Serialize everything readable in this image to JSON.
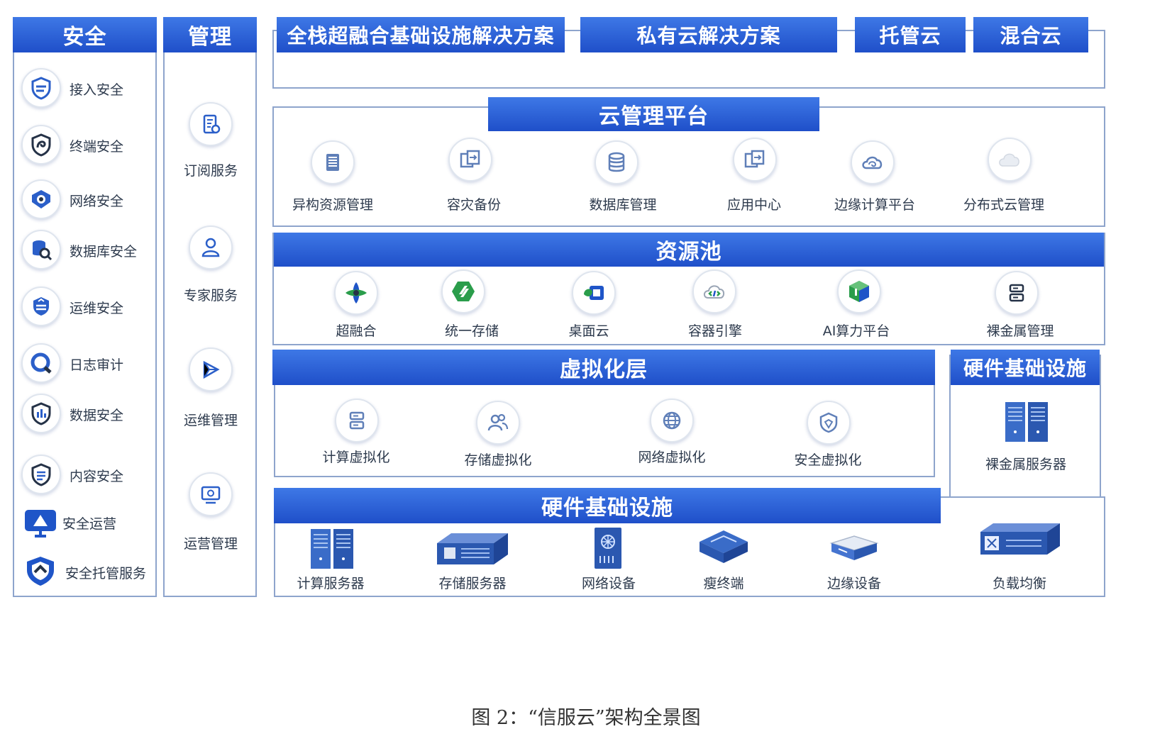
{
  "security": {
    "title": "安全",
    "items": [
      {
        "label": "接入安全",
        "icon": "access-shield-icon"
      },
      {
        "label": "终端安全",
        "icon": "terminal-shield-icon"
      },
      {
        "label": "网络安全",
        "icon": "network-shield-icon"
      },
      {
        "label": "数据库安全",
        "icon": "database-search-icon"
      },
      {
        "label": "运维安全",
        "icon": "ops-shield-icon"
      },
      {
        "label": "日志审计",
        "icon": "log-audit-icon"
      },
      {
        "label": "数据安全",
        "icon": "data-shield-icon"
      },
      {
        "label": "内容安全",
        "icon": "content-shield-icon"
      },
      {
        "label": "安全运营",
        "icon": "monitor-ops-icon"
      },
      {
        "label": "安全托管服务",
        "icon": "managed-shield-icon"
      }
    ]
  },
  "management": {
    "title": "管理",
    "items": [
      {
        "label": "订阅服务",
        "icon": "subscription-doc-icon"
      },
      {
        "label": "专家服务",
        "icon": "expert-person-icon"
      },
      {
        "label": "运维管理",
        "icon": "ops-nodes-icon"
      },
      {
        "label": "运营管理",
        "icon": "operations-monitor-icon"
      }
    ]
  },
  "solutions": {
    "full_stack": "全栈超融合基础设施解决方案",
    "private_cloud": "私有云解决方案",
    "hosted_cloud": "托管云",
    "hybrid_cloud": "混合云"
  },
  "cloud_platform": {
    "title": "云管理平台",
    "items": [
      {
        "label": "异构资源管理",
        "icon": "server-rack-icon"
      },
      {
        "label": "容灾备份",
        "icon": "backup-transfer-icon"
      },
      {
        "label": "数据库管理",
        "icon": "database-icon"
      },
      {
        "label": "应用中心",
        "icon": "app-transfer-icon"
      },
      {
        "label": "边缘计算平台",
        "icon": "edge-cloud-icon"
      },
      {
        "label": "分布式云管理",
        "icon": "cloud-icon"
      }
    ]
  },
  "resource_pool": {
    "title": "资源池",
    "items": [
      {
        "label": "超融合",
        "icon": "hci-logo-icon"
      },
      {
        "label": "统一存储",
        "icon": "storage-logo-icon"
      },
      {
        "label": "桌面云",
        "icon": "desktop-cloud-logo-icon"
      },
      {
        "label": "容器引擎",
        "icon": "container-cloud-icon"
      },
      {
        "label": "AI算力平台",
        "icon": "ai-cube-icon"
      },
      {
        "label": "裸金属管理",
        "icon": "baremetal-server-icon"
      }
    ]
  },
  "virtualization": {
    "title": "虚拟化层",
    "items": [
      {
        "label": "计算虚拟化",
        "icon": "compute-server-icon"
      },
      {
        "label": "存储虚拟化",
        "icon": "storage-users-icon"
      },
      {
        "label": "网络虚拟化",
        "icon": "globe-icon"
      },
      {
        "label": "安全虚拟化",
        "icon": "security-shield-icon"
      }
    ]
  },
  "hardware_right": {
    "title": "硬件基础设施",
    "item": {
      "label": "裸金属服务器",
      "icon": "baremetal-rack-icon"
    }
  },
  "hardware": {
    "title": "硬件基础设施",
    "items": [
      {
        "label": "计算服务器",
        "icon": "compute-rack-icon"
      },
      {
        "label": "存储服务器",
        "icon": "storage-box-icon"
      },
      {
        "label": "网络设备",
        "icon": "network-device-icon"
      },
      {
        "label": "瘦终端",
        "icon": "thin-client-icon"
      },
      {
        "label": "边缘设备",
        "icon": "edge-device-icon"
      },
      {
        "label": "负载均衡",
        "icon": "load-balancer-icon"
      }
    ]
  },
  "caption": "图 2：“信服云”架构全景图",
  "colors": {
    "header_blue": "#2757d6",
    "frame": "#8ea4cc",
    "icon_blue": "#2b5fc9"
  }
}
